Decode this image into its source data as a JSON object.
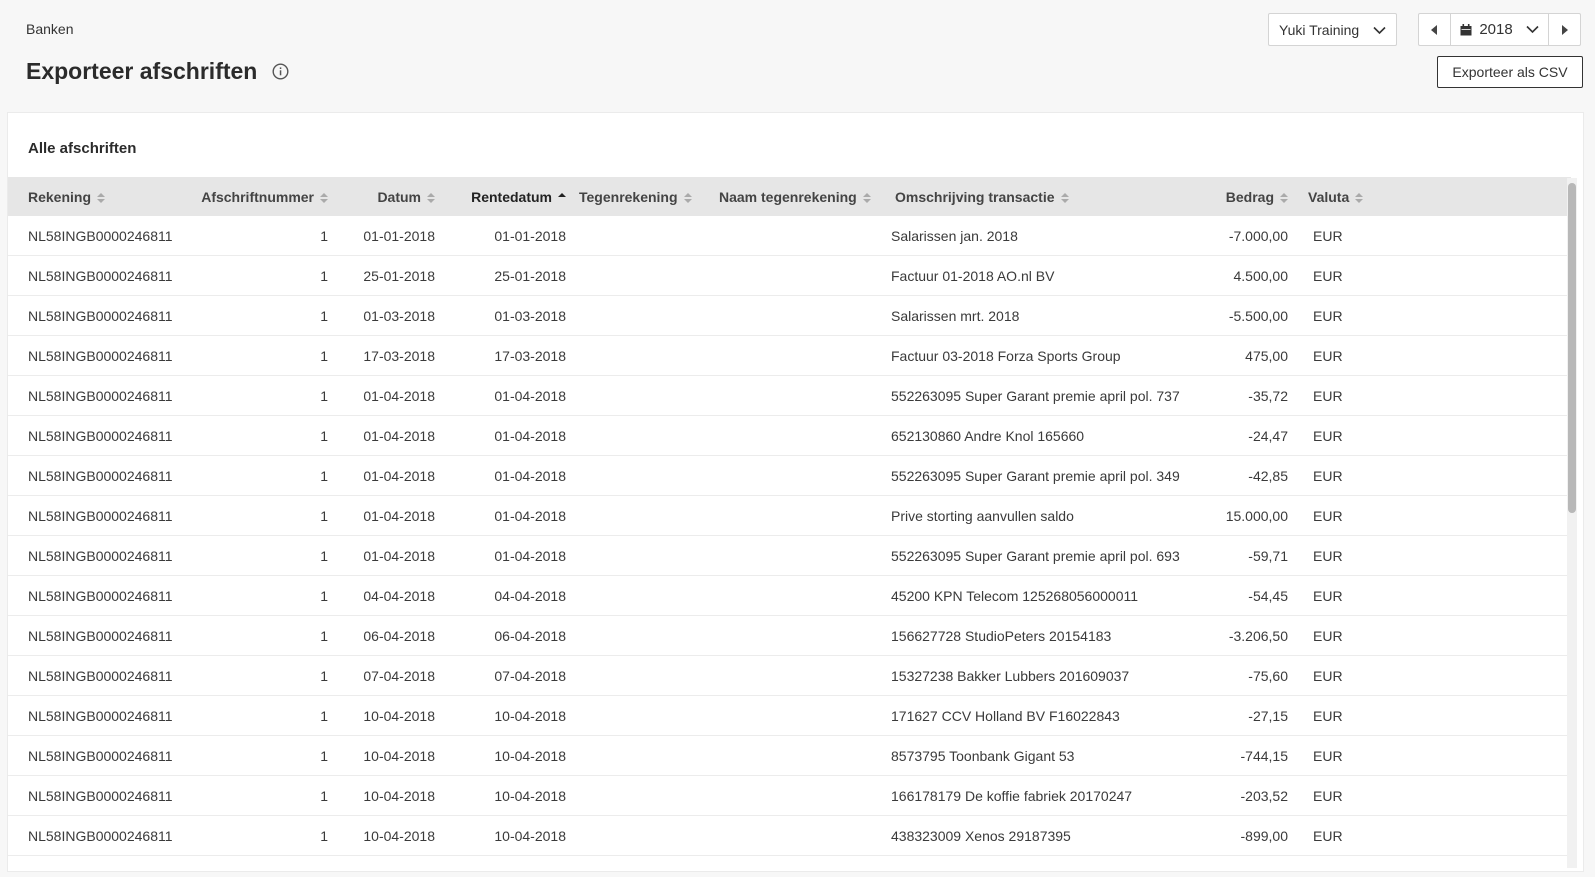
{
  "breadcrumb": "Banken",
  "page_title": "Exporteer afschriften",
  "company_select": {
    "value": "Yuki Training"
  },
  "year_nav": {
    "year": "2018"
  },
  "export_label": "Exporteer als CSV",
  "panel_title": "Alle afschriften",
  "columns": [
    {
      "key": "rekening",
      "label": "Rekening"
    },
    {
      "key": "afschriftnummer",
      "label": "Afschriftnummer"
    },
    {
      "key": "datum",
      "label": "Datum"
    },
    {
      "key": "rentedatum",
      "label": "Rentedatum",
      "sorted": "asc"
    },
    {
      "key": "tegenrekening",
      "label": "Tegenrekening"
    },
    {
      "key": "naam_tegenrekening",
      "label": "Naam tegenrekening"
    },
    {
      "key": "omschrijving",
      "label": "Omschrijving transactie"
    },
    {
      "key": "bedrag",
      "label": "Bedrag"
    },
    {
      "key": "valuta",
      "label": "Valuta"
    }
  ],
  "rows": [
    [
      "NL58INGB0000246811",
      "1",
      "01-01-2018",
      "01-01-2018",
      "",
      "",
      "Salarissen jan. 2018",
      "-7.000,00",
      "EUR"
    ],
    [
      "NL58INGB0000246811",
      "1",
      "25-01-2018",
      "25-01-2018",
      "",
      "",
      "Factuur 01-2018 AO.nl BV",
      "4.500,00",
      "EUR"
    ],
    [
      "NL58INGB0000246811",
      "1",
      "01-03-2018",
      "01-03-2018",
      "",
      "",
      "Salarissen mrt. 2018",
      "-5.500,00",
      "EUR"
    ],
    [
      "NL58INGB0000246811",
      "1",
      "17-03-2018",
      "17-03-2018",
      "",
      "",
      "Factuur 03-2018 Forza Sports Group",
      "475,00",
      "EUR"
    ],
    [
      "NL58INGB0000246811",
      "1",
      "01-04-2018",
      "01-04-2018",
      "",
      "",
      "552263095 Super Garant premie april pol. 737",
      "-35,72",
      "EUR"
    ],
    [
      "NL58INGB0000246811",
      "1",
      "01-04-2018",
      "01-04-2018",
      "",
      "",
      "652130860 Andre Knol 165660",
      "-24,47",
      "EUR"
    ],
    [
      "NL58INGB0000246811",
      "1",
      "01-04-2018",
      "01-04-2018",
      "",
      "",
      "552263095 Super Garant premie april pol. 349",
      "-42,85",
      "EUR"
    ],
    [
      "NL58INGB0000246811",
      "1",
      "01-04-2018",
      "01-04-2018",
      "",
      "",
      "Prive storting aanvullen saldo",
      "15.000,00",
      "EUR"
    ],
    [
      "NL58INGB0000246811",
      "1",
      "01-04-2018",
      "01-04-2018",
      "",
      "",
      "552263095 Super Garant premie april pol. 693",
      "-59,71",
      "EUR"
    ],
    [
      "NL58INGB0000246811",
      "1",
      "04-04-2018",
      "04-04-2018",
      "",
      "",
      "45200 KPN Telecom 125268056000011",
      "-54,45",
      "EUR"
    ],
    [
      "NL58INGB0000246811",
      "1",
      "06-04-2018",
      "06-04-2018",
      "",
      "",
      "156627728 StudioPeters 20154183",
      "-3.206,50",
      "EUR"
    ],
    [
      "NL58INGB0000246811",
      "1",
      "07-04-2018",
      "07-04-2018",
      "",
      "",
      "15327238 Bakker Lubbers 201609037",
      "-75,60",
      "EUR"
    ],
    [
      "NL58INGB0000246811",
      "1",
      "10-04-2018",
      "10-04-2018",
      "",
      "",
      "171627 CCV Holland BV F16022843",
      "-27,15",
      "EUR"
    ],
    [
      "NL58INGB0000246811",
      "1",
      "10-04-2018",
      "10-04-2018",
      "",
      "",
      "8573795 Toonbank Gigant 53",
      "-744,15",
      "EUR"
    ],
    [
      "NL58INGB0000246811",
      "1",
      "10-04-2018",
      "10-04-2018",
      "",
      "",
      "166178179 De koffie fabriek 20170247",
      "-203,52",
      "EUR"
    ],
    [
      "NL58INGB0000246811",
      "1",
      "10-04-2018",
      "10-04-2018",
      "",
      "",
      "438323009 Xenos 29187395",
      "-899,00",
      "EUR"
    ]
  ]
}
